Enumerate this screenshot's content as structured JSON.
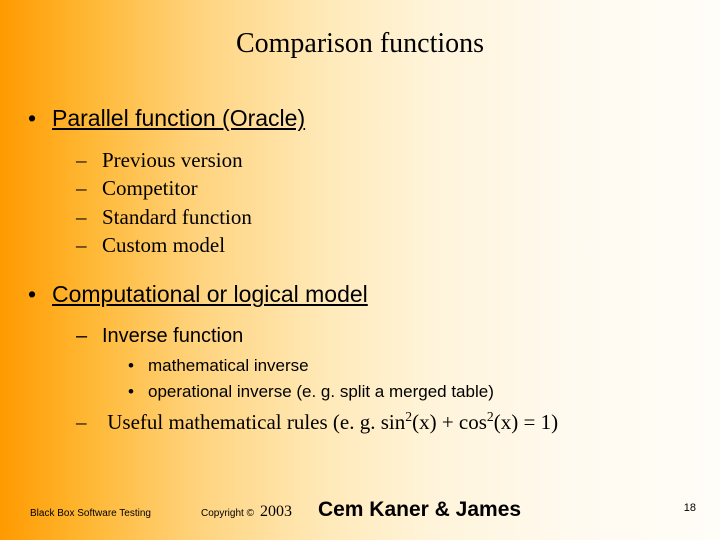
{
  "title": "Comparison functions",
  "bullets": {
    "b1": "Parallel function (Oracle)",
    "b1_items": [
      "Previous version",
      "Competitor",
      "Standard function",
      "Custom model"
    ],
    "b2": "Computational or logical model",
    "b2_sub1": "Inverse function",
    "b2_sub1_items": [
      "mathematical inverse",
      "operational inverse (e. g. split a merged table)"
    ],
    "b2_sub2_prefix": "Useful mathematical rules (e. g. sin",
    "b2_sub2_mid": "(x) + cos",
    "b2_sub2_suffix": "(x) = 1)",
    "sup": "2"
  },
  "footer": {
    "left": "Black Box Software Testing",
    "copy": "Copyright ©",
    "year": "2003",
    "authors": "Cem Kaner & James"
  },
  "page": "18"
}
